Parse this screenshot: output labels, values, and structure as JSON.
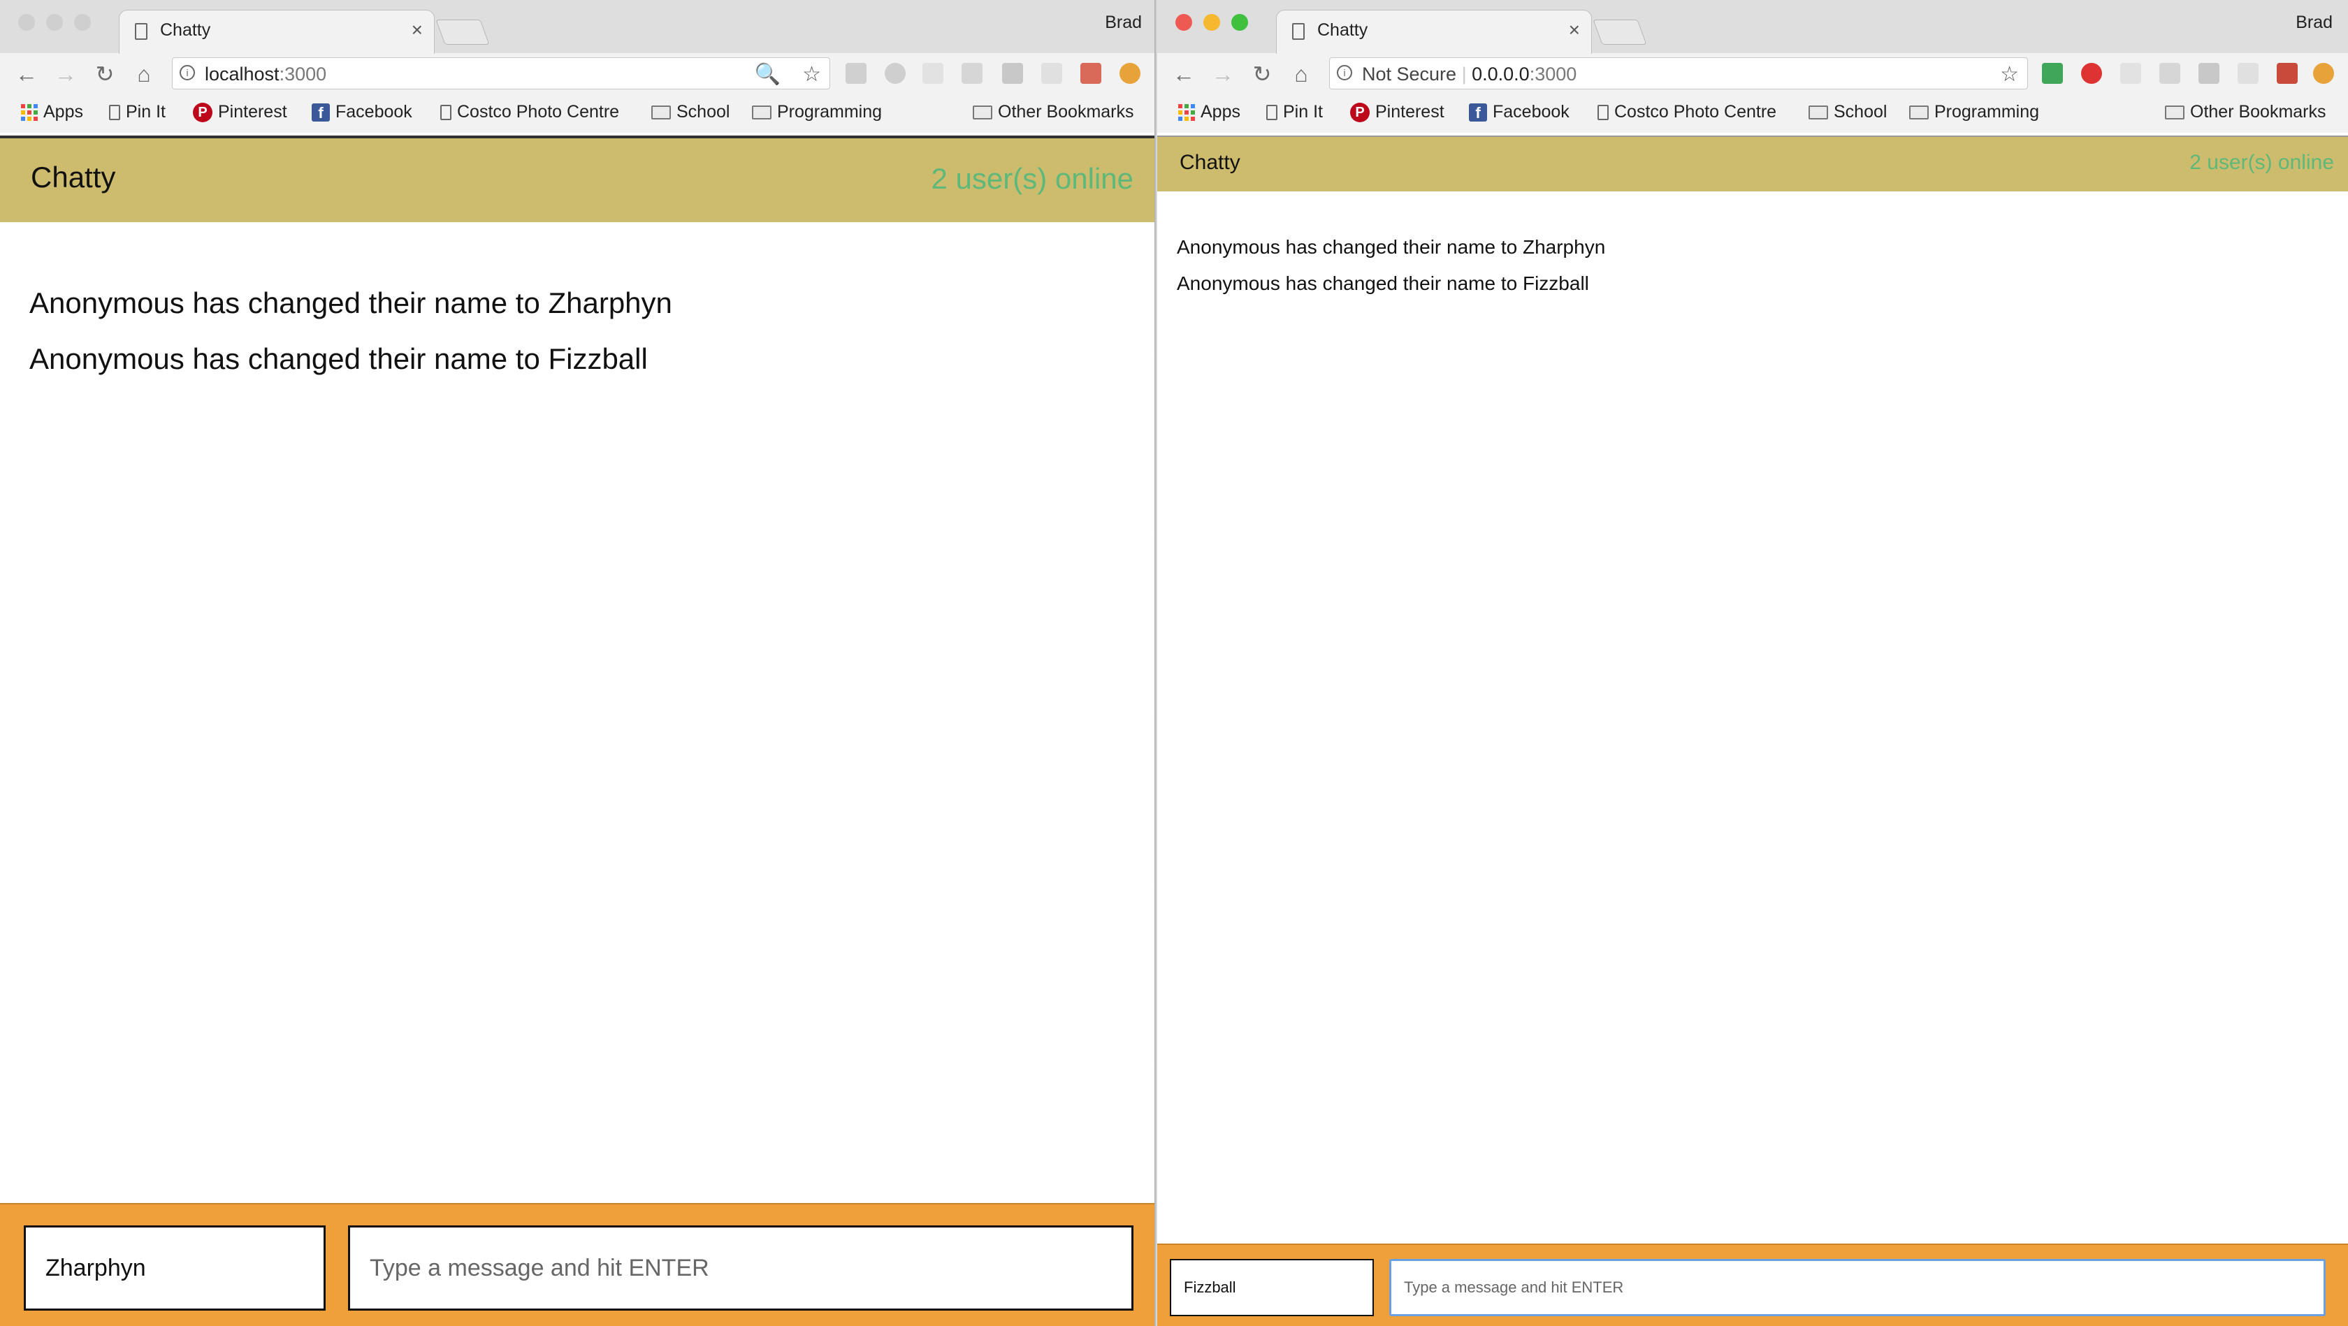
{
  "left_window": {
    "tab_title": "Chatty",
    "profile": "Brad",
    "url_host": "localhost",
    "url_port": ":3000",
    "bookmarks": [
      "Apps",
      "Pin It",
      "Pinterest",
      "Facebook",
      "Costco Photo Centre",
      "School",
      "Programming",
      "Other Bookmarks"
    ],
    "app": {
      "brand": "Chatty",
      "online": "2 user(s) online",
      "messages": [
        "Anonymous has changed their name to Zharphyn",
        "Anonymous has changed their name to Fizzball"
      ],
      "username_value": "Zharphyn",
      "message_placeholder": "Type a message and hit ENTER"
    }
  },
  "right_window": {
    "tab_title": "Chatty",
    "profile": "Brad",
    "security_label": "Not Secure",
    "url_host": "0.0.0.0",
    "url_port": ":3000",
    "bookmarks": [
      "Apps",
      "Pin It",
      "Pinterest",
      "Facebook",
      "Costco Photo Centre",
      "School",
      "Programming",
      "Other Bookmarks"
    ],
    "app": {
      "brand": "Chatty",
      "online": "2 user(s) online",
      "messages": [
        "Anonymous has changed their name to Zharphyn",
        "Anonymous has changed their name to Fizzball"
      ],
      "username_value": "Fizzball",
      "message_placeholder": "Type a message and hit ENTER"
    }
  },
  "colors": {
    "navbar": "#cdbc6e",
    "online_text": "#5db87a",
    "chatbar": "#f0a03a"
  },
  "ext_badge": "0"
}
